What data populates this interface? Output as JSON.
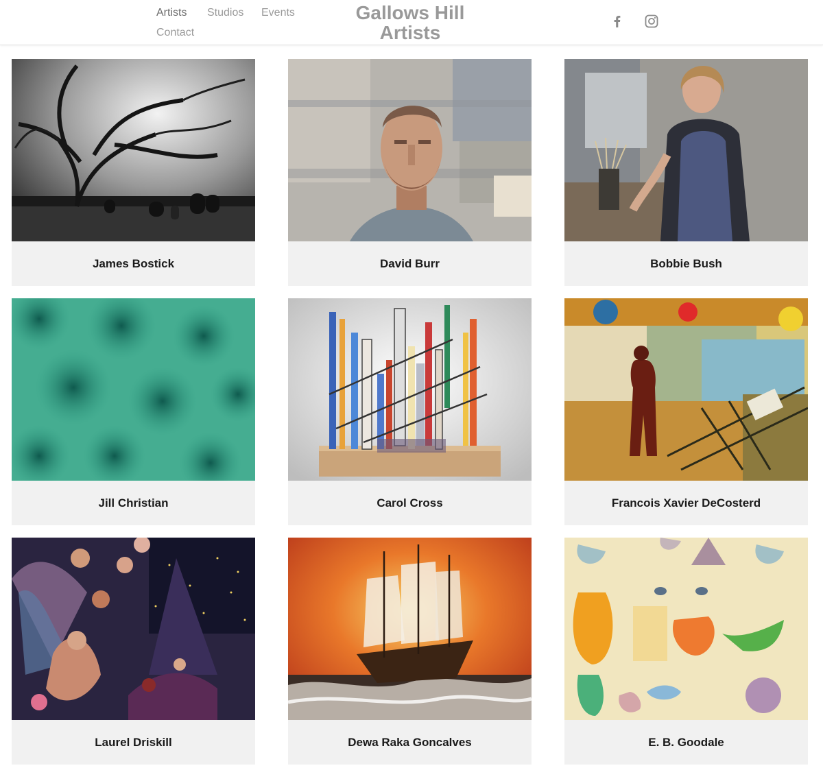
{
  "header": {
    "nav": [
      {
        "label": "Artists",
        "active": true
      },
      {
        "label": "Studios",
        "active": false
      },
      {
        "label": "Events",
        "active": false
      },
      {
        "label": "Contact",
        "active": false
      }
    ],
    "logo_line1": "Gallows Hill",
    "logo_line2": "Artists",
    "social": [
      "facebook-icon",
      "instagram-icon"
    ]
  },
  "artists": [
    {
      "name": "James Bostick",
      "artwork": "black-and-white photograph of a tree over a graveyard"
    },
    {
      "name": "David Burr",
      "artwork": "painted self-portrait"
    },
    {
      "name": "Bobbie Bush",
      "artwork": "painted portrait of a woman in an apron beside brushes"
    },
    {
      "name": "Jill Christian",
      "artwork": "green textured abstract"
    },
    {
      "name": "Carol Cross",
      "artwork": "stained glass sculpture on a wooden base"
    },
    {
      "name": "Francois Xavier DeCosterd",
      "artwork": "colorful mixed-media collage with figure"
    },
    {
      "name": "Laurel Driskill",
      "artwork": "fantasy collage with fairy figures"
    },
    {
      "name": "Dewa Raka Goncalves",
      "artwork": "oil painting of a sailing ship in a fiery sea"
    },
    {
      "name": "E. B. Goodale",
      "artwork": "watercolor of glass vessels and a face"
    }
  ]
}
